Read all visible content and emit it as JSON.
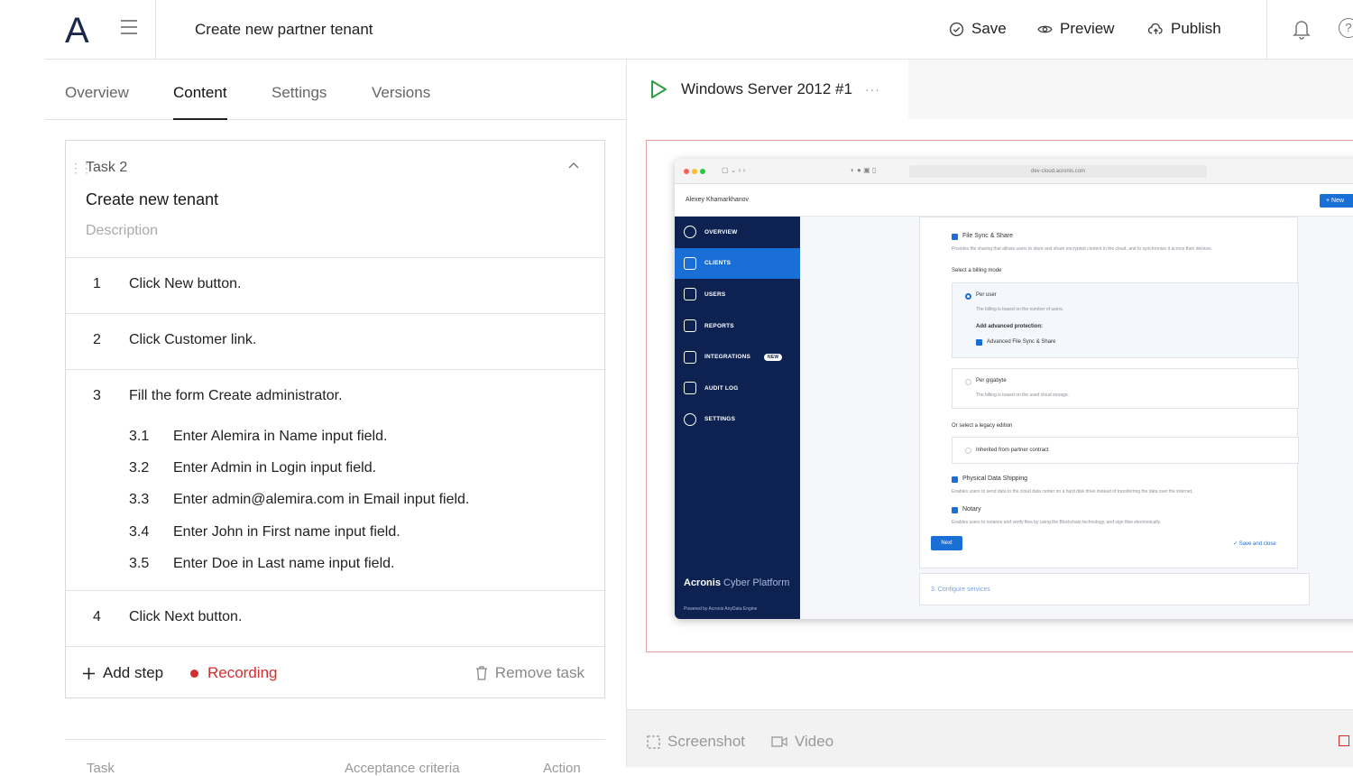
{
  "header": {
    "logo": "A",
    "title": "Create new partner tenant",
    "save_label": "Save",
    "preview_label": "Preview",
    "publish_label": "Publish"
  },
  "tabs": [
    "Overview",
    "Content",
    "Settings",
    "Versions"
  ],
  "active_tab": "Content",
  "task": {
    "label": "Task 2",
    "name": "Create new tenant",
    "description_placeholder": "Description",
    "steps": [
      {
        "num": "1",
        "text": "Click New button."
      },
      {
        "num": "2",
        "text": "Click Customer link."
      },
      {
        "num": "3",
        "text": "Fill the form Create administrator.",
        "substeps": [
          {
            "num": "3.1",
            "text": "Enter Alemira in Name input field."
          },
          {
            "num": "3.2",
            "text": "Enter Admin in Login input field."
          },
          {
            "num": "3.3",
            "text": "Enter admin@alemira.com in Email input field."
          },
          {
            "num": "3.4",
            "text": "Enter John in First name input field."
          },
          {
            "num": "3.5",
            "text": "Enter Doe in Last name input field."
          }
        ]
      },
      {
        "num": "4",
        "text": "Click Next button."
      }
    ],
    "add_step_label": "Add step",
    "recording_label": "Recording",
    "remove_task_label": "Remove task"
  },
  "bottom_partial": [
    "Task",
    "Acceptance criteria",
    "Action"
  ],
  "right": {
    "env_tab_label": "Windows Server 2012 #1",
    "more": "···",
    "screenshot_label": "Screenshot",
    "video_label": "Video"
  },
  "embedded": {
    "url": "dev-cloud.acronis.com",
    "account_name": "Alexey Khamarkhanov",
    "new_button": "New",
    "nav": [
      "OVERVIEW",
      "CLIENTS",
      "USERS",
      "REPORTS",
      "INTEGRATIONS",
      "AUDIT LOG",
      "SETTINGS"
    ],
    "nav_active": "CLIENTS",
    "new_tag": "NEW",
    "brand_bold": "Acronis",
    "brand_light": "Cyber Platform",
    "powered": "Powered by Acronis AnyData Engine",
    "file_sync_title": "File Sync & Share",
    "file_sync_desc": "Provides file sharing that allows users to store and share encrypted content in the cloud, and to synchronize it across their devices.",
    "billing_mode": "Select a billing mode",
    "per_user": "Per user",
    "per_user_desc": "The billing is based on the number of users.",
    "adv_protection": "Add advanced protection:",
    "adv_fss": "Advanced File Sync & Share",
    "per_gb": "Per gigabyte",
    "per_gb_desc": "The billing is based on the used cloud storage.",
    "legacy": "Or select a legacy edition",
    "inherited": "Inherited from partner contract",
    "pds": "Physical Data Shipping",
    "pds_desc": "Enables users to send data to the cloud data center on a hard disk drive instead of transferring the data over the internet.",
    "notary": "Notary",
    "notary_desc": "Enables users to notarize and verify files by using the Blockchain technology, and sign files electronically.",
    "next": "Next",
    "save_close": "✓ Save and close",
    "configure": "3. Configure services"
  }
}
